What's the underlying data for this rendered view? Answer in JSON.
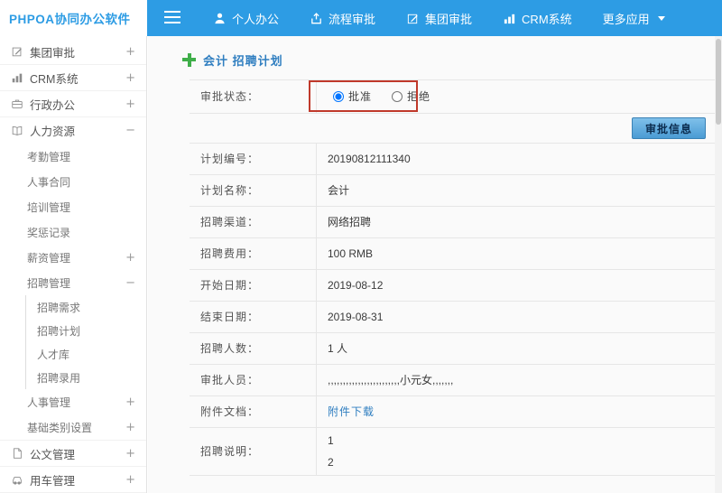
{
  "colors": {
    "topbar_blue": "#2d9ce4",
    "accent_blue": "#2f7ec0",
    "annotation_red": "#c0392b",
    "plus_green": "#3fae49"
  },
  "topbar": {
    "logo": "PHPOA协同办公软件",
    "nav": [
      {
        "label": "个人办公",
        "icon": "person-icon"
      },
      {
        "label": "流程审批",
        "icon": "workflow-icon"
      },
      {
        "label": "集团审批",
        "icon": "edit-square-icon"
      },
      {
        "label": "CRM系统",
        "icon": "bar-chart-icon"
      },
      {
        "label": "更多应用",
        "icon": "caret-down-icon"
      }
    ]
  },
  "sidebar": {
    "items": [
      {
        "label": "集团审批",
        "toggle": "+",
        "icon": "edit-square-icon"
      },
      {
        "label": "CRM系统",
        "toggle": "+",
        "icon": "bar-chart-icon"
      },
      {
        "label": "行政办公",
        "toggle": "+",
        "icon": "briefcase-icon"
      },
      {
        "label": "人力资源",
        "toggle": "−",
        "icon": "book-icon"
      },
      {
        "label": "公文管理",
        "toggle": "+",
        "icon": "document-icon"
      },
      {
        "label": "用车管理",
        "toggle": "+",
        "icon": "car-icon"
      }
    ],
    "hr_children": [
      {
        "label": "考勤管理"
      },
      {
        "label": "人事合同"
      },
      {
        "label": "培训管理"
      },
      {
        "label": "奖惩记录"
      },
      {
        "label": "薪资管理",
        "toggle": "+"
      },
      {
        "label": "招聘管理",
        "toggle": "−"
      },
      {
        "label": "人事管理",
        "toggle": "+"
      },
      {
        "label": "基础类别设置",
        "toggle": "+"
      }
    ],
    "recruit_children": [
      {
        "label": "招聘需求"
      },
      {
        "label": "招聘计划"
      },
      {
        "label": "人才库"
      },
      {
        "label": "招聘录用"
      }
    ]
  },
  "main": {
    "title": "会计 招聘计划",
    "status": {
      "label": "审批状态：",
      "options": [
        {
          "label": "批准",
          "selected": true
        },
        {
          "label": "拒绝",
          "selected": false
        }
      ]
    },
    "approve_button": "审批信息",
    "rows": [
      {
        "label": "计划编号：",
        "value": "20190812111340"
      },
      {
        "label": "计划名称：",
        "value": "会计"
      },
      {
        "label": "招聘渠道：",
        "value": "网络招聘"
      },
      {
        "label": "招聘费用：",
        "value": "100 RMB"
      },
      {
        "label": "开始日期：",
        "value": "2019-08-12"
      },
      {
        "label": "结束日期：",
        "value": "2019-08-31"
      },
      {
        "label": "招聘人数：",
        "value": "1 人"
      },
      {
        "label": "审批人员：",
        "value": ",,,,,,,,,,,,,,,,,,,,,,,,小元女,,,,,,,"
      },
      {
        "label": "附件文档：",
        "value": "附件下载"
      },
      {
        "label": "招聘说明：",
        "lines": [
          "1",
          "2"
        ]
      }
    ]
  }
}
